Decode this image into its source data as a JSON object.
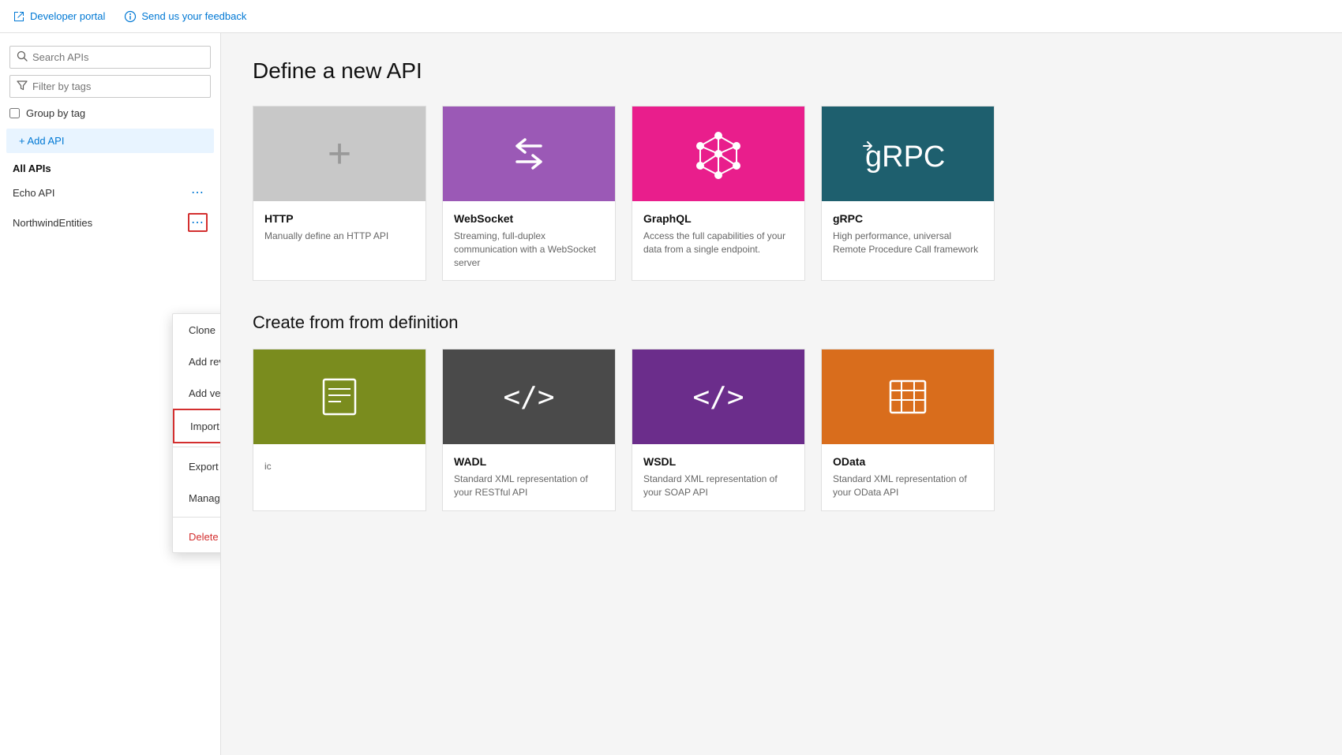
{
  "topbar": {
    "developer_portal_label": "Developer portal",
    "feedback_label": "Send us your feedback"
  },
  "sidebar": {
    "search_placeholder": "Search APIs",
    "filter_placeholder": "Filter by tags",
    "group_by_tag_label": "Group by tag",
    "add_api_label": "+ Add API",
    "all_apis_label": "All APIs",
    "apis": [
      {
        "name": "Echo API",
        "id": "echo-api",
        "dots_highlighted": false
      },
      {
        "name": "NorthwindEntities",
        "id": "northwind-entities",
        "dots_highlighted": true
      }
    ]
  },
  "context_menu": {
    "items": [
      {
        "id": "clone",
        "label": "Clone",
        "icon": "clone-icon",
        "highlighted": false,
        "danger": false
      },
      {
        "id": "add-revision",
        "label": "Add revision",
        "icon": "revision-icon",
        "highlighted": false,
        "danger": false
      },
      {
        "id": "add-version",
        "label": "Add version",
        "icon": "version-icon",
        "highlighted": false,
        "danger": false
      },
      {
        "id": "import",
        "label": "Import",
        "icon": "import-icon",
        "highlighted": true,
        "danger": false
      },
      {
        "id": "export",
        "label": "Export",
        "icon": "export-icon",
        "highlighted": false,
        "danger": false
      },
      {
        "id": "manage-power-connector",
        "label": "Manage Power Connector",
        "icon": "power-icon",
        "highlighted": false,
        "danger": false
      },
      {
        "id": "delete",
        "label": "Delete",
        "icon": "delete-icon",
        "highlighted": false,
        "danger": true
      }
    ]
  },
  "main": {
    "define_title": "Define a new API",
    "from_def_title": "from definition",
    "api_cards_row1": [
      {
        "id": "http",
        "color": "gray",
        "title": "HTTP",
        "description": "Manually define an HTTP API",
        "icon_type": "plus"
      },
      {
        "id": "websocket",
        "color": "purple",
        "title": "WebSocket",
        "description": "Streaming, full-duplex communication with a WebSocket server",
        "icon_type": "arrows"
      },
      {
        "id": "graphql",
        "color": "magenta",
        "title": "GraphQL",
        "description": "Access the full capabilities of your data from a single endpoint.",
        "icon_type": "graphql"
      },
      {
        "id": "grpc",
        "color": "dark-teal",
        "title": "gRPC",
        "description": "High performance, universal Remote Procedure Call framework",
        "icon_type": "grpc"
      }
    ],
    "api_cards_row2": [
      {
        "id": "openapi-logic",
        "color": "olive",
        "title": "",
        "description": "ic",
        "icon_type": "code"
      },
      {
        "id": "wadl",
        "color": "dark-gray",
        "title": "WADL",
        "description": "Standard XML representation of your RESTful API",
        "icon_type": "code"
      },
      {
        "id": "wsdl",
        "color": "dark-purple",
        "title": "WSDL",
        "description": "Standard XML representation of your SOAP API",
        "icon_type": "code"
      },
      {
        "id": "odata",
        "color": "orange",
        "title": "OData",
        "description": "Standard XML representation of your OData API",
        "icon_type": "table"
      }
    ]
  }
}
